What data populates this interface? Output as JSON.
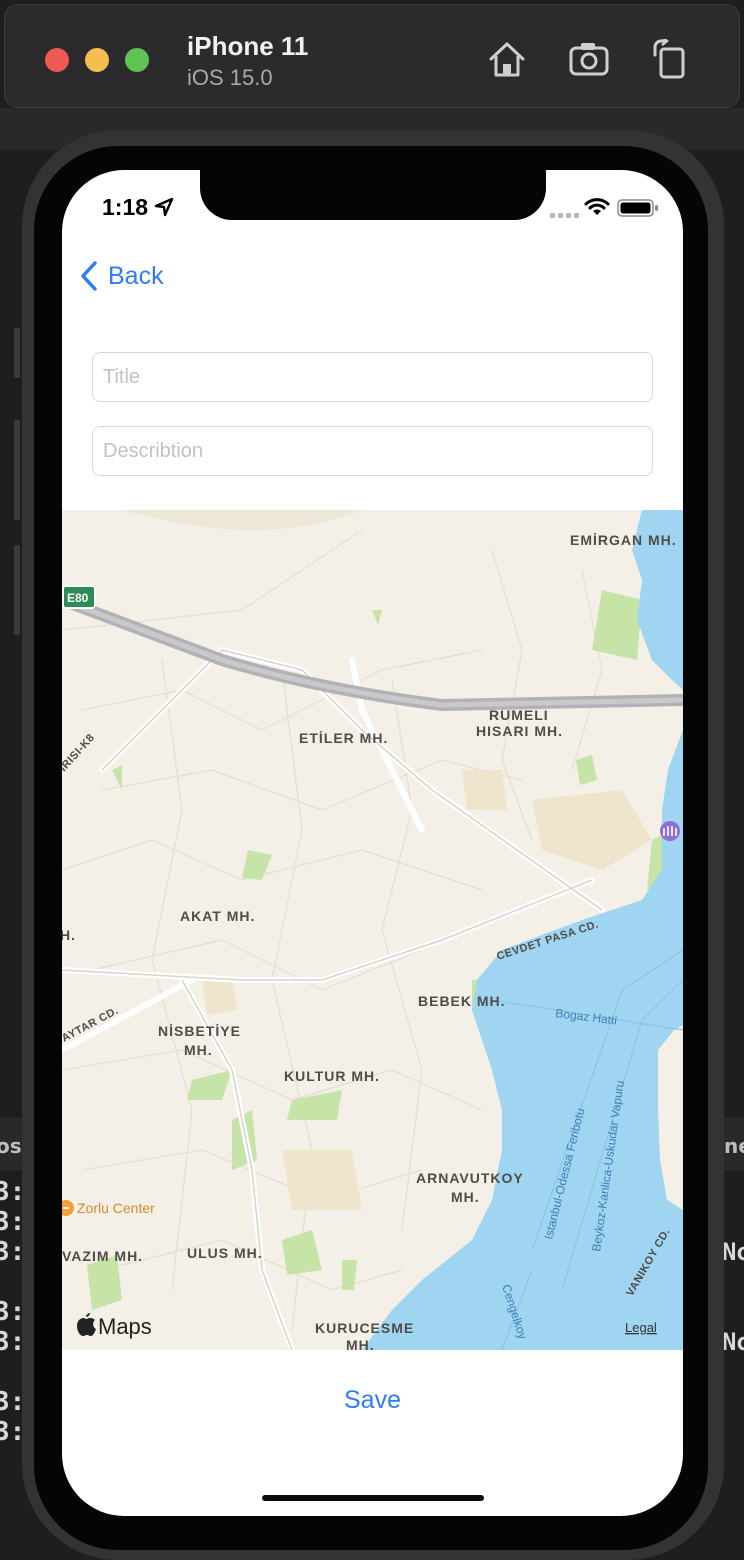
{
  "window": {
    "device_name": "iPhone 11",
    "os_version": "iOS 15.0",
    "icons": [
      "home-icon",
      "screenshot-icon",
      "rotate-icon"
    ],
    "background_code": {
      "left_lines": [
        "3:",
        "3:",
        "3:",
        "3:",
        "3:",
        "3:",
        "3:"
      ],
      "right_fragments": [
        "No",
        "No"
      ],
      "partial_left": "os",
      "partial_right": "ne"
    }
  },
  "status_bar": {
    "time": "1:18"
  },
  "nav": {
    "back_label": "Back"
  },
  "form": {
    "title_placeholder": "Title",
    "description_placeholder": "Describtion"
  },
  "map": {
    "labels": {
      "emirgan": "EMİRGAN MH.",
      "e80": "E80",
      "etiler": "ETİLER MH.",
      "rumeli1": "RUMELI",
      "rumeli2": "HISARI MH.",
      "k8": "IRISI-K8",
      "akat": "AKAT MH.",
      "h": "H.",
      "cevdet": "CEVDET PASA CD.",
      "bebek": "BEBEK MH.",
      "bogaz": "Bogaz Hatti",
      "nisbetiye1": "NİSBETİYE",
      "nisbetiye2": "MH.",
      "aytar": "AYTAR CD.",
      "kultur": "KULTUR MH.",
      "istanbul_odessa": "Istanbul-Odessa Feribotu",
      "beykoz": "Beykoz-Kanlica-Uskudar Vapuru",
      "arnavutkoy1": "ARNAVUTKOY",
      "arnavutkoy2": "MH.",
      "zorlu": "Zorlu Center",
      "vazim": "VAZIM MH.",
      "ulus": "ULUS MH.",
      "vanikoy": "VANIKOY CD.",
      "cengelkoy": "Cengelkoy",
      "kurucesme1": "KURUCESME",
      "kurucesme2": "MH."
    },
    "attribution": "Maps",
    "legal": "Legal"
  },
  "actions": {
    "save_label": "Save"
  },
  "colors": {
    "accent": "#2f7cf6",
    "water": "#9fd5f1",
    "land": "#f4efe7",
    "park": "#c6e4a7",
    "highway": "#b2b2b6"
  }
}
